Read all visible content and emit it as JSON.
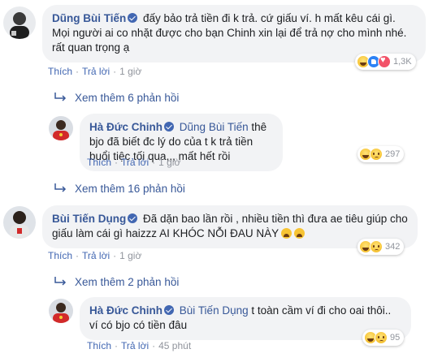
{
  "comments": [
    {
      "author": "Dũng Bùi Tiến",
      "text": "đấy bảo trả tiền đi k trả. cứ giấu ví. h mất kêu cái gì. Mọi người ai co nhặt được cho bạn Chinh xin lại để trả nợ cho mình nhé. rất quan trọng ạ",
      "like_label": "Thích",
      "reply_label": "Trả lời",
      "time": "1 giờ",
      "reaction_count": "1,3K",
      "view_more": "Xem thêm 6 phản hồi"
    },
    {
      "author": "Hà Đức Chinh",
      "mention": "Dũng Bùi Tiến",
      "text": "thê bjo đã biết đc lý do của t k trả tiền buổi tiệc tối qua,,, mất hết rồi",
      "like_label": "Thích",
      "reply_label": "Trả lời",
      "time": "1 giờ",
      "reaction_count": "297",
      "view_more": "Xem thêm 16 phản hồi"
    },
    {
      "author": "Bùi Tiến Dụng",
      "text": "Đã dặn bao lần rồi , nhiều tiền thì đưa ae tiêu giúp cho giấu làm cái gì haizzz AI KHÓC NỖI ĐAU NÀY",
      "like_label": "Thích",
      "reply_label": "Trả lời",
      "time": "1 giờ",
      "reaction_count": "342",
      "view_more": "Xem thêm 2 phản hồi"
    },
    {
      "author": "Hà Đức Chinh",
      "mention": "Bùi Tiến Dụng",
      "text": "t toàn cầm ví đi cho oai thôi.. ví có bjo có tiền đâu",
      "like_label": "Thích",
      "reply_label": "Trả lời",
      "time": "45 phút",
      "reaction_count": "95"
    }
  ],
  "colors": {
    "link": "#385898",
    "bubble": "#f2f3f5",
    "meta": "#90949c",
    "verified": "#4267b2"
  }
}
